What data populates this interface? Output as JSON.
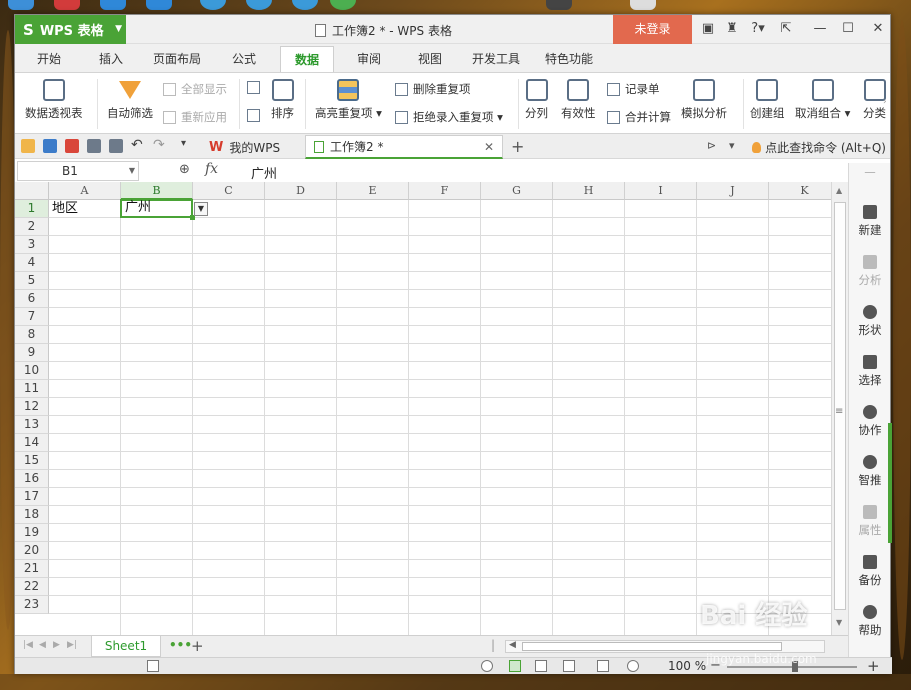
{
  "app": {
    "name": "WPS 表格",
    "title": "工作簿2 * - WPS 表格",
    "login_label": "未登录",
    "help_symbol": "?"
  },
  "menu_tabs": [
    "开始",
    "插入",
    "页面布局",
    "公式",
    "数据",
    "审阅",
    "视图",
    "开发工具",
    "特色功能"
  ],
  "active_menu_tab": "数据",
  "ribbon": {
    "pivot": "数据透视表",
    "autofilter": "自动筛选",
    "show_all": "全部显示",
    "reapply": "重新应用",
    "sort": "排序",
    "highlight_dup": "高亮重复项",
    "remove_dup": "删除重复项",
    "reject_dup": "拒绝录入重复项",
    "split": "分列",
    "validity": "有效性",
    "record_form": "记录单",
    "consolidate": "合并计算",
    "what_if": "模拟分析",
    "group": "创建组",
    "ungroup": "取消组合",
    "subtotal": "分类"
  },
  "doc_tabs": {
    "mywps": "我的WPS",
    "workbook": "工作簿2 *",
    "find_command": "点此查找命令 (Alt+Q)"
  },
  "formula_bar": {
    "name_box": "B1",
    "fx_label": "fx",
    "value": "广州"
  },
  "grid": {
    "columns": [
      "A",
      "B",
      "C",
      "D",
      "E",
      "F",
      "G",
      "H",
      "I",
      "J",
      "K"
    ],
    "rows": [
      "1",
      "2",
      "3",
      "4",
      "5",
      "6",
      "7",
      "8",
      "9",
      "10",
      "11",
      "12",
      "13",
      "14",
      "15",
      "16",
      "17",
      "18",
      "19",
      "20",
      "21",
      "22",
      "23"
    ],
    "cells": {
      "A1": "地区",
      "B1": "广州"
    },
    "selected_cell": "B1"
  },
  "task_pane": [
    "新建",
    "分析",
    "形状",
    "选择",
    "协作",
    "智推",
    "属性",
    "备份",
    "帮助"
  ],
  "sheets": [
    "Sheet1"
  ],
  "status": {
    "zoom": "100 %"
  },
  "watermark": {
    "brand": "Bai 经验",
    "url": "jingyan.baidu.com"
  }
}
